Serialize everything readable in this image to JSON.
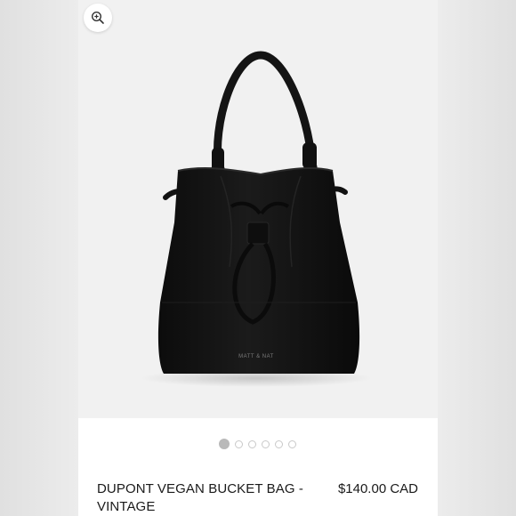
{
  "product": {
    "title": "DUPONT VEGAN BUCKET BAG - VINTAGE",
    "price": "$140.00 CAD",
    "brand_mark": "MATT & NAT",
    "gallery": {
      "image_count": 6,
      "active_index": 0
    }
  },
  "icons": {
    "zoom": "zoom-in-icon"
  },
  "colors": {
    "bag": "#121212",
    "background": "#f1f1f1",
    "card": "#ffffff"
  }
}
